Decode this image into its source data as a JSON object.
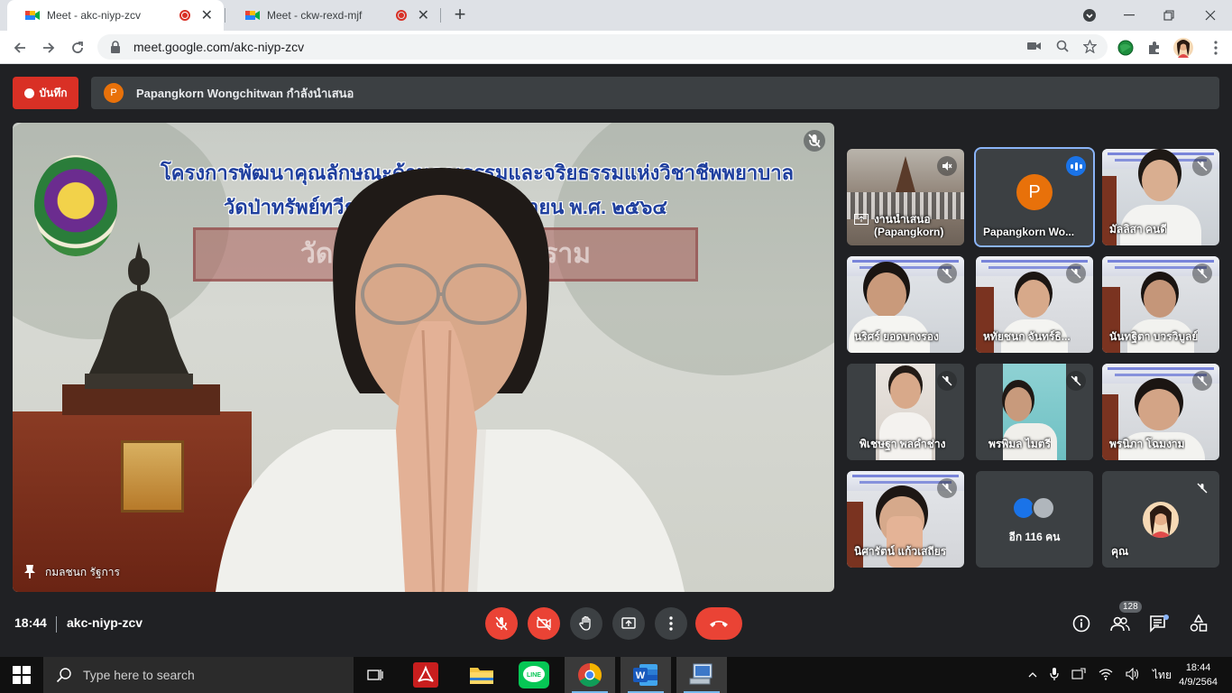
{
  "browser": {
    "tabs": [
      {
        "title": "Meet - akc-niyp-zcv",
        "active": true
      },
      {
        "title": "Meet - ckw-rexd-mjf",
        "active": false
      }
    ],
    "new_tab": "+",
    "url": "meet.google.com/akc-niyp-zcv"
  },
  "meet": {
    "recording_label": "บันทึก",
    "presenter_avatar": "P",
    "presenting_text": "Papangkorn Wongchitwan กำลังนำเสนอ",
    "main_video": {
      "slide_line1": "โครงการพัฒนาคุณลักษณะด้านคุณธรรมและจริยธรรมแห่งวิชาชีพพยาบาล",
      "slide_line2": "วัดป่าทรัพย์ทวีธรรมาราม ๑ - ๖ กันยายน พ.ศ. ๒๕๖๔",
      "sign_text": "วัดป่าทรัพย์ทวีธรรมาราม",
      "name": "กมลชนก รัฐการ"
    },
    "participants": [
      {
        "name": "งานนำเสนอ (Papangkorn)"
      },
      {
        "name": "Papangkorn Wo...",
        "avatar": "P"
      },
      {
        "name": "มัลลิสา คนดี"
      },
      {
        "name": "นริศร์ ยอดบางรอง"
      },
      {
        "name": "หทัยชนก จันทร์ธิ..."
      },
      {
        "name": "นันทฐิตา บวรวิบูลย์"
      },
      {
        "name": "พิเชษฐา พลคำช่าง"
      },
      {
        "name": "พรพิมล ไมตรี"
      },
      {
        "name": "พรนิภา โฉมงาม"
      },
      {
        "name": "นิศารัตน์ แก้วเสถียร"
      },
      {
        "name": "อีก 116 คน"
      },
      {
        "name": "คุณ"
      }
    ],
    "time": "18:44",
    "meeting_code": "akc-niyp-zcv",
    "participant_count": "128"
  },
  "taskbar": {
    "search_placeholder": "Type here to search",
    "language": "ไทย",
    "clock_time": "18:44",
    "clock_date": "4/9/2564"
  },
  "colors": {
    "meet_bg": "#202124",
    "tile_bg": "#3c4043",
    "red": "#ea4335",
    "recording_red": "#d93025",
    "avatar_orange": "#e8710a",
    "highlight_blue": "#8ab4f8"
  }
}
